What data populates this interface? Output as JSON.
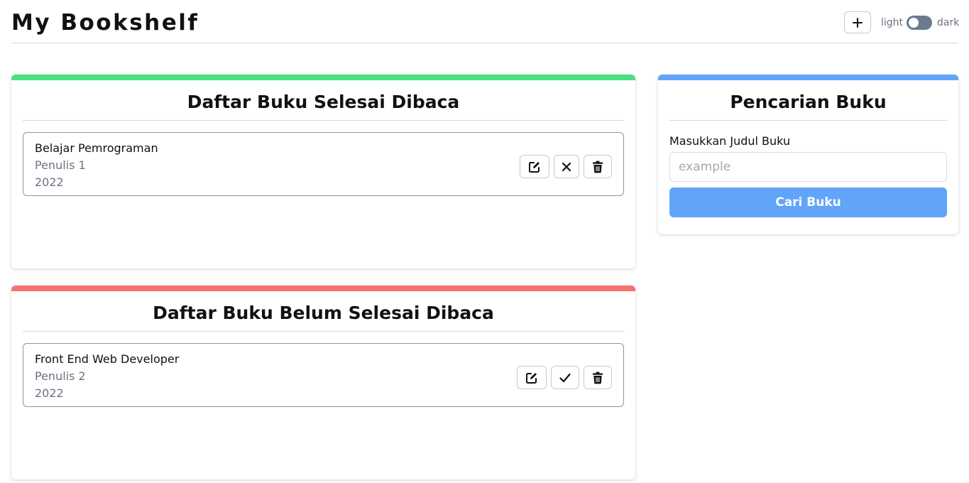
{
  "header": {
    "title": "My Bookshelf",
    "add_icon": "plus-icon",
    "theme_light_label": "light",
    "theme_dark_label": "dark",
    "theme_toggle_state": "light"
  },
  "colors": {
    "finished_accent": "#4ade80",
    "unfinished_accent": "#f87171",
    "search_accent": "#60a5fa",
    "search_button": "#60a5fa",
    "toggle_track": "#6b7a8f"
  },
  "finished_section": {
    "title": "Daftar Buku Selesai Dibaca",
    "books": [
      {
        "title": "Belajar Pemrograman",
        "author": "Penulis 1",
        "year": "2022",
        "actions": [
          "edit-icon",
          "close-icon",
          "trash-icon"
        ]
      }
    ]
  },
  "unfinished_section": {
    "title": "Daftar Buku Belum Selesai Dibaca",
    "books": [
      {
        "title": "Front End Web Developer",
        "author": "Penulis 2",
        "year": "2022",
        "actions": [
          "edit-icon",
          "check-icon",
          "trash-icon"
        ]
      }
    ]
  },
  "search": {
    "title": "Pencarian Buku",
    "label": "Masukkan Judul Buku",
    "placeholder": "example",
    "value": "",
    "button_label": "Cari Buku"
  }
}
